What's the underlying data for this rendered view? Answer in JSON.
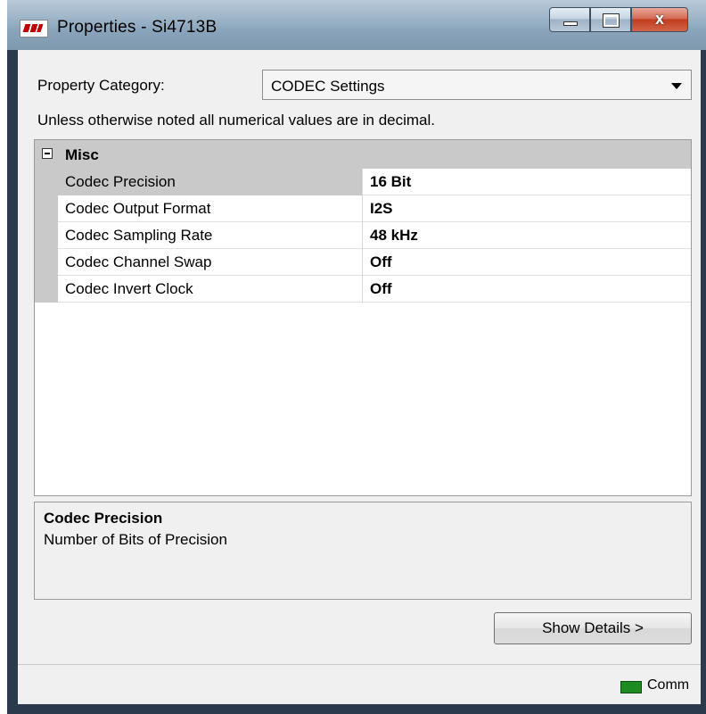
{
  "window": {
    "title": "Properties - Si4713B",
    "controls": {
      "minimize": "minimize",
      "maximize": "maximize",
      "close": "x"
    }
  },
  "category": {
    "label": "Property Category:",
    "selected": "CODEC Settings"
  },
  "note": "Unless otherwise noted all numerical values are in decimal.",
  "grid": {
    "group": "Misc",
    "rows": [
      {
        "name": "Codec Precision",
        "value": "16 Bit"
      },
      {
        "name": "Codec Output Format",
        "value": "I2S"
      },
      {
        "name": "Codec Sampling Rate",
        "value": "48 kHz"
      },
      {
        "name": "Codec Channel Swap",
        "value": "Off"
      },
      {
        "name": "Codec Invert Clock",
        "value": "Off"
      }
    ]
  },
  "help": {
    "title": "Codec Precision",
    "description": "Number of Bits of Precision"
  },
  "buttons": {
    "details": "Show Details >"
  },
  "status": {
    "comm": "Comm",
    "indicator_color": "#1d8a22"
  },
  "icons": {
    "app": "silicon-labs-logo-icon",
    "expander": "collapse-minus-icon",
    "dropdown": "chevron-down-icon"
  }
}
